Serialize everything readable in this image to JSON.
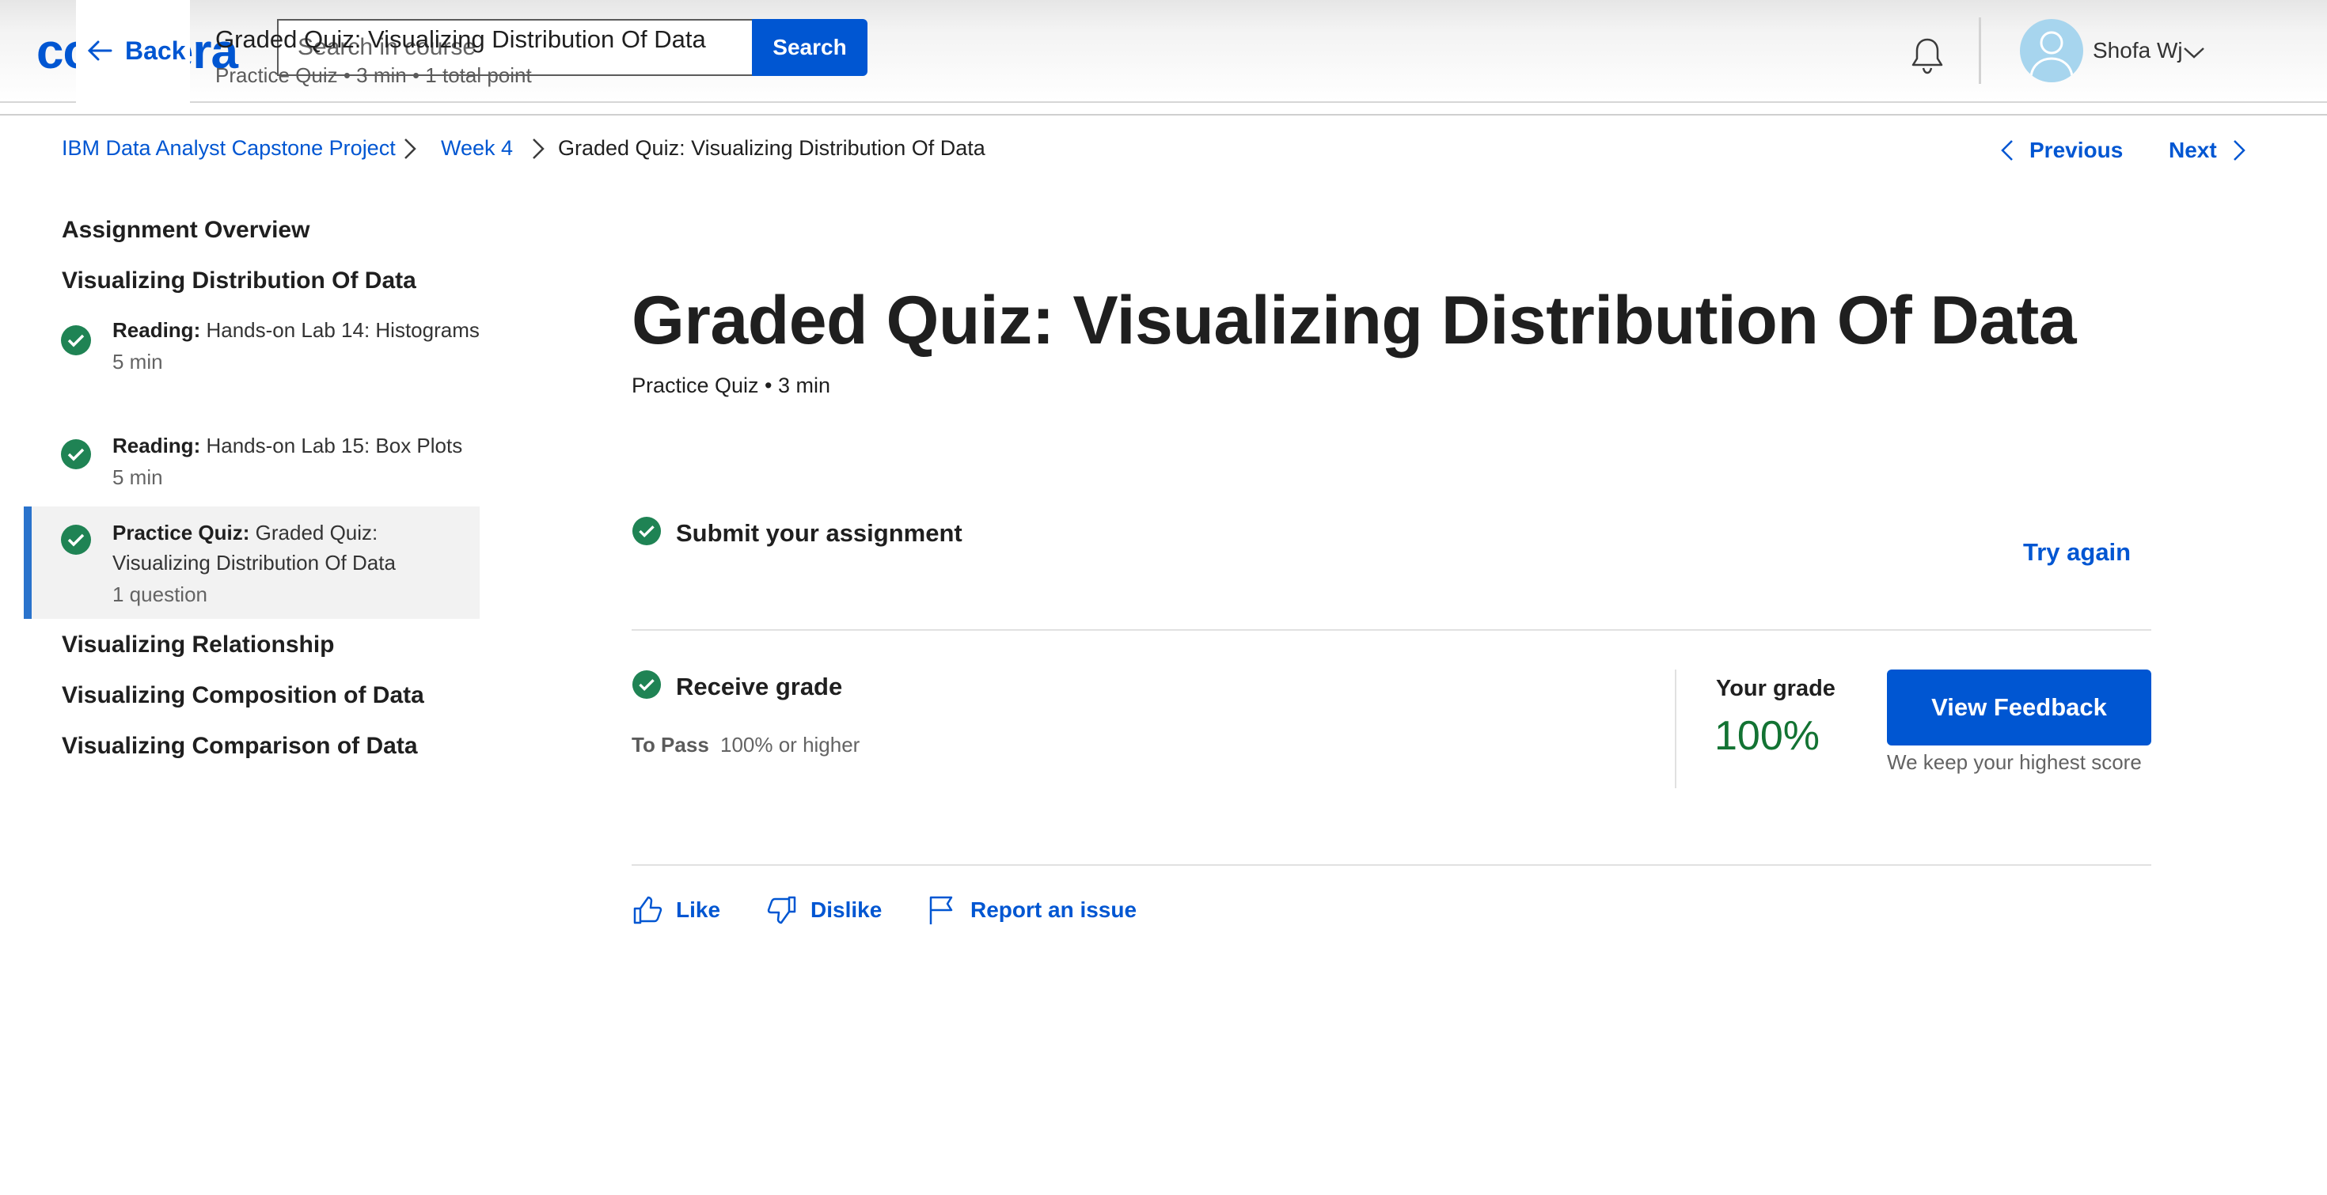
{
  "header": {
    "logo": "coursera",
    "back_label": "Back",
    "search_placeholder": "Search in course",
    "search_button": "Search",
    "overlay_title": "Graded Quiz: Visualizing Distribution Of Data",
    "overlay_subtitle": "Practice Quiz • 3 min • 1 total point",
    "user_name": "Shofa Wj"
  },
  "breadcrumb": {
    "items": [
      "IBM Data Analyst Capstone Project",
      "Week 4",
      "Graded Quiz: Visualizing Distribution Of Data"
    ]
  },
  "pager": {
    "previous": "Previous",
    "next": "Next"
  },
  "sidebar": {
    "overview": "Assignment Overview",
    "section_current": "Visualizing Distribution Of Data",
    "items": [
      {
        "type": "Reading:",
        "title": "Hands-on Lab 14: Histograms",
        "meta": "5 min",
        "completed": true
      },
      {
        "type": "Reading:",
        "title": "Hands-on Lab 15: Box Plots",
        "meta": "5 min",
        "completed": true
      },
      {
        "type": "Practice Quiz:",
        "title": "Graded Quiz: Visualizing Distribution Of Data",
        "meta": "1 question",
        "completed": true,
        "active": true
      }
    ],
    "sections": [
      "Visualizing Relationship",
      "Visualizing Composition of Data",
      "Visualizing Comparison of Data"
    ]
  },
  "main": {
    "title": "Graded Quiz: Visualizing Distribution Of Data",
    "subtitle": "Practice Quiz • 3 min",
    "submit_step": "Submit your assignment",
    "try_again": "Try again",
    "receive_step": "Receive grade",
    "to_pass_label": "To Pass",
    "to_pass_value": "100% or higher",
    "your_grade_label": "Your grade",
    "your_grade_value": "100%",
    "view_feedback": "View Feedback",
    "keep_note": "We keep your highest score",
    "actions": {
      "like": "Like",
      "dislike": "Dislike",
      "report": "Report an issue"
    }
  },
  "colors": {
    "brand": "#0056d2",
    "success": "#137333",
    "check": "#1f8354"
  },
  "icons": [
    "arrow-left-icon",
    "bell-icon",
    "avatar-icon",
    "chevron-down-icon",
    "chevron-right-icon",
    "chevron-left-icon",
    "check-circle-icon",
    "thumbs-up-icon",
    "thumbs-down-icon",
    "flag-icon"
  ]
}
